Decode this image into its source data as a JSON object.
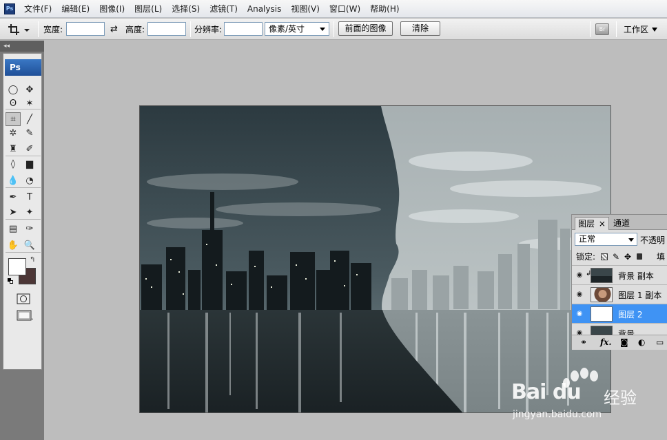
{
  "menu": {
    "app_icon_label": "Ps",
    "items": [
      {
        "label": "文件(F)"
      },
      {
        "label": "编辑(E)"
      },
      {
        "label": "图像(I)"
      },
      {
        "label": "图层(L)"
      },
      {
        "label": "选择(S)"
      },
      {
        "label": "滤镜(T)"
      },
      {
        "label": "Analysis"
      },
      {
        "label": "视图(V)"
      },
      {
        "label": "窗口(W)"
      },
      {
        "label": "帮助(H)"
      }
    ]
  },
  "options": {
    "width_label": "宽度:",
    "width_value": "",
    "height_label": "高度:",
    "height_value": "",
    "resolution_label": "分辨率:",
    "resolution_value": "",
    "unit_value": "像素/英寸",
    "front_image_button": "前面的图像",
    "clear_button": "清除",
    "bridge_label": "Br",
    "workspace_label": "工作区"
  },
  "toolbox": {
    "logo": "Ps",
    "tools": [
      {
        "name": "elliptical-marquee-tool-icon",
        "glyph": "◯"
      },
      {
        "name": "move-tool-icon",
        "glyph": "✥"
      },
      {
        "name": "lasso-tool-icon",
        "glyph": "ʘ"
      },
      {
        "name": "magic-wand-tool-icon",
        "glyph": "✶"
      },
      {
        "name": "crop-tool-icon",
        "glyph": "⌗"
      },
      {
        "name": "eyedropper-slice-icon",
        "glyph": "╱"
      },
      {
        "name": "spot-healing-brush-icon",
        "glyph": "✲"
      },
      {
        "name": "brush-tool-icon",
        "glyph": "✎"
      },
      {
        "name": "clone-stamp-tool-icon",
        "glyph": "♜"
      },
      {
        "name": "history-brush-tool-icon",
        "glyph": "✐"
      },
      {
        "name": "eraser-tool-icon",
        "glyph": "◊"
      },
      {
        "name": "gradient-tool-icon",
        "glyph": "▆"
      },
      {
        "name": "blur-tool-icon",
        "glyph": "💧"
      },
      {
        "name": "dodge-tool-icon",
        "glyph": "◔"
      },
      {
        "name": "pen-tool-icon",
        "glyph": "✒"
      },
      {
        "name": "type-tool-icon",
        "glyph": "T"
      },
      {
        "name": "path-selection-tool-icon",
        "glyph": "➤"
      },
      {
        "name": "custom-shape-tool-icon",
        "glyph": "✦"
      },
      {
        "name": "notes-tool-icon",
        "glyph": "▤"
      },
      {
        "name": "color-sampler-icon",
        "glyph": "✑"
      },
      {
        "name": "hand-tool-icon",
        "glyph": "✋"
      },
      {
        "name": "zoom-tool-icon",
        "glyph": "🔍"
      }
    ],
    "foreground_color": "#ffffff",
    "background_color": "#4c3636"
  },
  "layers_panel": {
    "tab_layers": "图层",
    "tab_close": "×",
    "tab_channels": "通道",
    "blend_mode": "正常",
    "opacity_label": "不透明",
    "lock_label": "锁定:",
    "fill_label": "填",
    "layers": [
      {
        "name": "背景 副本",
        "selected": false
      },
      {
        "name": "图层 1 副本",
        "selected": false
      },
      {
        "name": "图层 2",
        "selected": true
      },
      {
        "name": "背景",
        "selected": false
      }
    ],
    "footer_fx": "fx."
  },
  "watermark": {
    "brand": "Bai du",
    "brand_suffix": "经验",
    "url": "jingyan.baidu.com"
  }
}
